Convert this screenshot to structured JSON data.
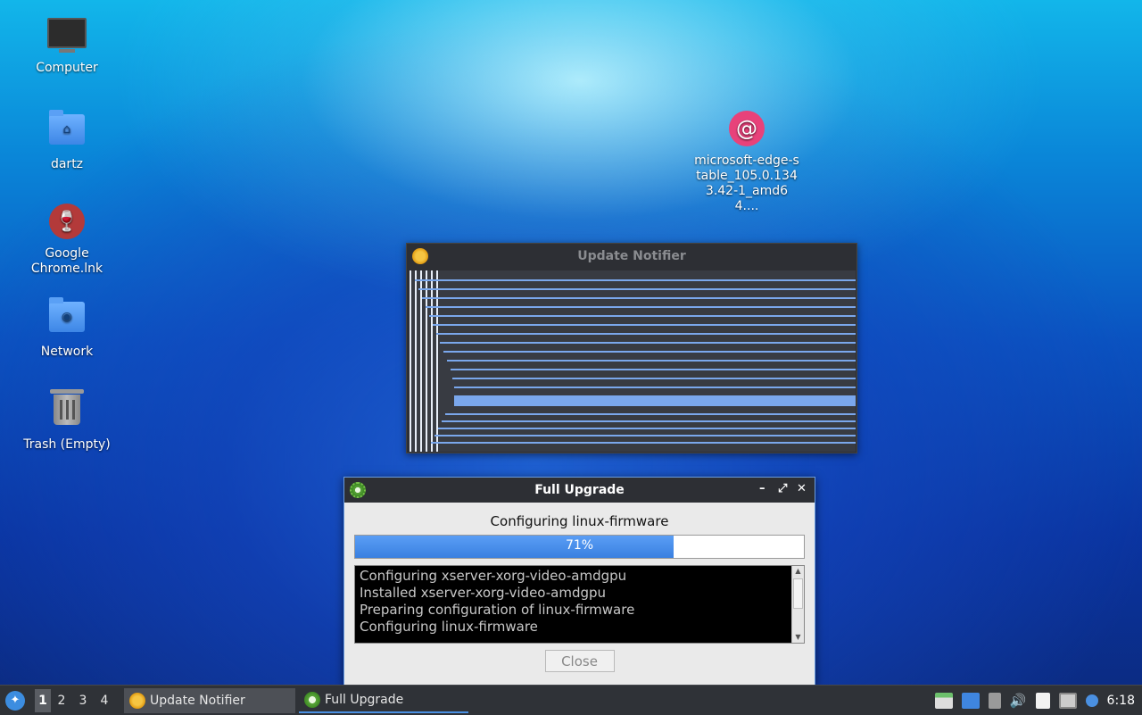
{
  "desktop": {
    "icons": [
      {
        "label": "Computer"
      },
      {
        "label": "dartz"
      },
      {
        "label": "Google Chrome.lnk"
      },
      {
        "label": "Network"
      },
      {
        "label": "Trash (Empty)"
      },
      {
        "label": "microsoft-edge-stable_105.0.1343.42-1_amd64...."
      }
    ]
  },
  "notifier_window": {
    "title": "Update Notifier"
  },
  "upgrade_window": {
    "title": "Full Upgrade",
    "status": "Configuring linux-firmware",
    "progress_percent": 71,
    "progress_label": "71%",
    "log_lines": [
      "Configuring xserver-xorg-video-amdgpu",
      "Installed xserver-xorg-video-amdgpu",
      "Preparing configuration of linux-firmware",
      "Configuring linux-firmware"
    ],
    "close_label": "Close",
    "controls": {
      "minimize": "–",
      "maximize": "⤢",
      "close": "✕"
    }
  },
  "taskbar": {
    "workspaces": [
      "1",
      "2",
      "3",
      "4"
    ],
    "tasks": [
      {
        "label": "Update Notifier"
      },
      {
        "label": "Full Upgrade"
      }
    ],
    "clock": "6:18"
  },
  "colors": {
    "accent": "#3a80e0",
    "taskbar_bg": "#2f3237",
    "titlebar_bg": "#2d2f34"
  }
}
